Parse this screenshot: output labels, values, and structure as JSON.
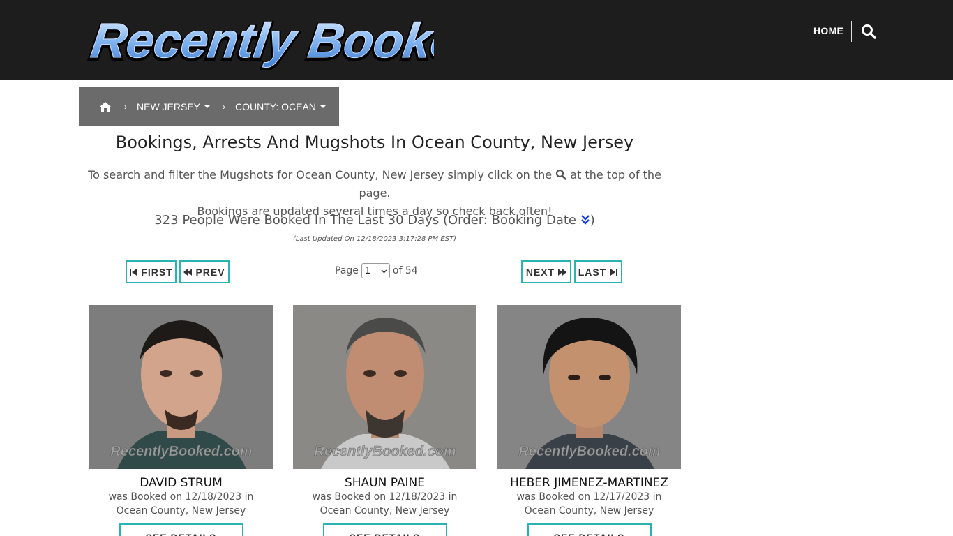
{
  "header": {
    "logo_text": "Recently Booked",
    "nav_home": "HOME"
  },
  "breadcrumb": {
    "sep": "›",
    "state": "NEW JERSEY",
    "county": "COUNTY: OCEAN"
  },
  "page": {
    "title": "Bookings, Arrests And Mugshots In Ocean County, New Jersey",
    "intro_a": "To search and filter the Mugshots for Ocean County, New Jersey simply click on the",
    "intro_b": "at the top of the page.",
    "intro_c": "Bookings are updated several times a day so check back often!",
    "count_text": "323 People Were Booked In The Last 30 Days (Order: Booking Date",
    "count_close": ")",
    "updated": "(Last Updated On 12/18/2023 3:17:28 PM EST)"
  },
  "pager": {
    "first": "FIRST",
    "prev": "PREV",
    "next": "NEXT",
    "last": "LAST",
    "page_label": "Page",
    "current_page": "1",
    "of_label": "of 54"
  },
  "cards": [
    {
      "name": "DAVID STRUM",
      "line1": "was Booked on 12/18/2023 in",
      "line2": "Ocean County, New Jersey",
      "watermark": "RecentlyBooked.com",
      "button": "SEE DETAILS"
    },
    {
      "name": "SHAUN PAINE",
      "line1": "was Booked on 12/18/2023 in",
      "line2": "Ocean County, New Jersey",
      "watermark": "RecentlyBooked.com",
      "button": "SEE DETAILS"
    },
    {
      "name": "HEBER JIMENEZ-MARTINEZ",
      "line1": "was Booked on 12/17/2023 in",
      "line2": "Ocean County, New Jersey",
      "watermark": "RecentlyBooked.com",
      "button": "SEE DETAILS"
    }
  ],
  "colors": {
    "header_bg": "#1d1d1d",
    "breadcrumb_bg": "#6b6b6b",
    "accent": "#2ab3b0",
    "logo_blue": "#6fa8ea"
  }
}
